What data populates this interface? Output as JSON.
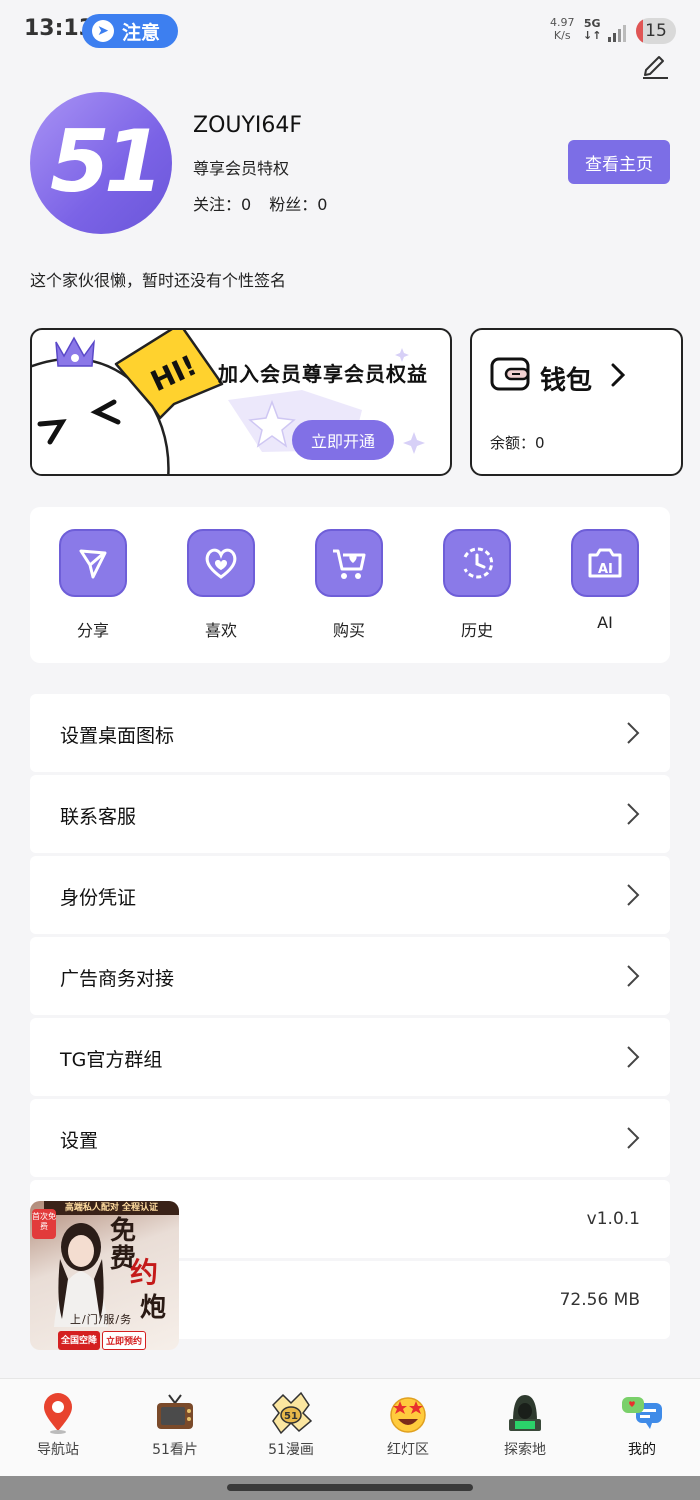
{
  "status_bar": {
    "time": "13:13",
    "notice_label": "注意",
    "net_speed_value": "4.97",
    "net_speed_unit": "K/s",
    "net_type": "5G",
    "battery": "15"
  },
  "profile": {
    "username": "ZOUYI64F",
    "vip_privilege": "尊享会员特权",
    "following_label": "关注：",
    "following_count": "0",
    "fans_label": "粉丝：",
    "fans_count": "0",
    "view_home_button": "查看主页",
    "signature": "这个家伙很懒，暂时还没有个性签名",
    "avatar_text": "51"
  },
  "vip_banner": {
    "bubble_text": "HI!",
    "title": "加入会员尊享会员权益",
    "button": "立即开通"
  },
  "wallet": {
    "label": "钱包",
    "balance_label": "余额：",
    "balance_value": "0"
  },
  "quick_actions": [
    {
      "label": "分享",
      "icon": "share-icon"
    },
    {
      "label": "喜欢",
      "icon": "heart-icon"
    },
    {
      "label": "购买",
      "icon": "cart-icon"
    },
    {
      "label": "历史",
      "icon": "history-icon"
    },
    {
      "label": "AI",
      "icon": "ai-camera-icon"
    }
  ],
  "menu": [
    {
      "label": "设置桌面图标"
    },
    {
      "label": "联系客服"
    },
    {
      "label": "身份凭证"
    },
    {
      "label": "广告商务对接"
    },
    {
      "label": "TG官方群组"
    },
    {
      "label": "设置"
    }
  ],
  "info_rows": {
    "version": "v1.0.1",
    "cache_size": "72.56 MB"
  },
  "float_ad": {
    "top_text": "高端私人配对 全程认证",
    "badge": "首次免费",
    "line1": "免",
    "line1b": "费",
    "line2": "约",
    "line3": "炮",
    "sub": "上/门/服/务",
    "btn1": "全国空降",
    "btn2": "立即预约"
  },
  "bottom_nav": [
    {
      "label": "导航站",
      "icon": "location-pin-icon"
    },
    {
      "label": "51看片",
      "icon": "tv-icon"
    },
    {
      "label": "51漫画",
      "icon": "comic-icon"
    },
    {
      "label": "红灯区",
      "icon": "star-eyes-emoji-icon"
    },
    {
      "label": "探索地",
      "icon": "hacker-icon"
    },
    {
      "label": "我的",
      "icon": "chat-bubbles-icon",
      "active": true
    }
  ],
  "colors": {
    "accent": "#7c6ee6",
    "notice": "#3d7ff0",
    "background": "#f5f5f7"
  }
}
